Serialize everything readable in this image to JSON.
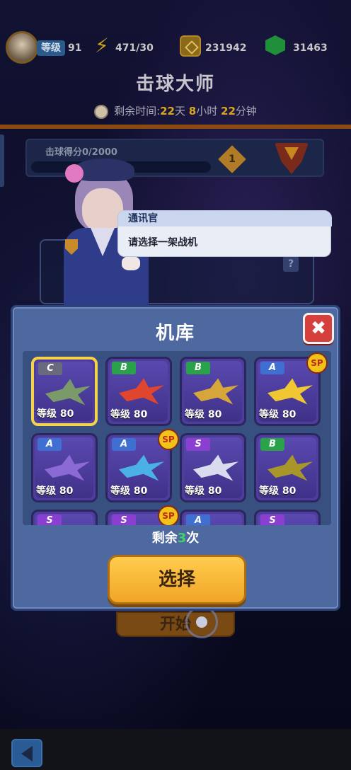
{
  "header": {
    "level_label": "等级",
    "level_value": "91",
    "energy": "471/30",
    "coins": "231942",
    "gems": "31463"
  },
  "event": {
    "title": "击球大师",
    "time_label": "剩余时间:",
    "days": "22",
    "days_unit": "天",
    "hours": "8",
    "hours_unit": "小时",
    "minutes": "22",
    "minutes_unit": "分钟",
    "score_label": "击球得分0/2000",
    "score_progress": 0,
    "rank_number": "1"
  },
  "dialog": {
    "speaker": "通讯官",
    "message": "请选择一架战机"
  },
  "hangar": {
    "title": "机库",
    "close_icon": "close-x-icon",
    "planes": [
      {
        "grade": "C",
        "level": "等级 80",
        "sp": false,
        "selected": true,
        "color": "#7a9a6a"
      },
      {
        "grade": "B",
        "level": "等级 80",
        "sp": false,
        "selected": false,
        "color": "#e0452e"
      },
      {
        "grade": "B",
        "level": "等级 80",
        "sp": false,
        "selected": false,
        "color": "#d6a63a"
      },
      {
        "grade": "A",
        "level": "等级 80",
        "sp": true,
        "selected": false,
        "color": "#f0c632"
      },
      {
        "grade": "A",
        "level": "等级 80",
        "sp": false,
        "selected": false,
        "color": "#8c6ad6"
      },
      {
        "grade": "A",
        "level": "等级 80",
        "sp": true,
        "selected": false,
        "color": "#4ab0e6"
      },
      {
        "grade": "S",
        "level": "等级 80",
        "sp": false,
        "selected": false,
        "color": "#d9dcef"
      },
      {
        "grade": "B",
        "level": "等级 80",
        "sp": false,
        "selected": false,
        "color": "#a8962a"
      },
      {
        "grade": "S",
        "level": "",
        "sp": false,
        "selected": false,
        "color": "#8a6ad6"
      },
      {
        "grade": "S",
        "level": "",
        "sp": true,
        "selected": false,
        "color": "#8a6ad6"
      },
      {
        "grade": "A",
        "level": "",
        "sp": false,
        "selected": false,
        "color": "#8a6ad6"
      },
      {
        "grade": "S",
        "level": "",
        "sp": false,
        "selected": false,
        "color": "#8a6ad6"
      }
    ],
    "sp_label": "SP",
    "remaining_prefix": "剩余",
    "remaining_count": "3",
    "remaining_suffix": "次",
    "select_label": "选择"
  },
  "background_start_label": "开始",
  "colors": {
    "accent_gold": "#f0a526",
    "modal_blue": "#4d699f",
    "close_red": "#d5403c",
    "remaining_green": "#3fd36a"
  }
}
